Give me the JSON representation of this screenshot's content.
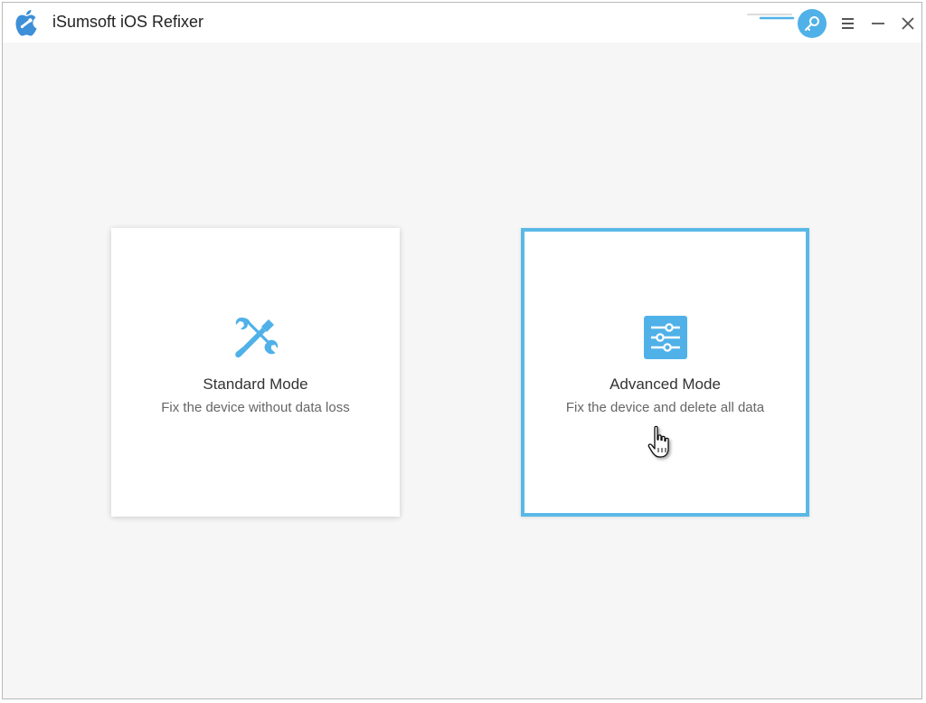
{
  "app": {
    "title": "iSumsoft iOS Refixer"
  },
  "titlebar": {
    "icons": [
      "apple-repair-logo",
      "key-icon",
      "menu-icon",
      "minimize-icon",
      "close-icon"
    ]
  },
  "modes": [
    {
      "title": "Standard Mode",
      "description": "Fix the device without data loss",
      "icon": "tools-icon",
      "selected": false
    },
    {
      "title": "Advanced Mode",
      "description": "Fix the device and delete all data",
      "icon": "sliders-icon",
      "selected": true
    }
  ],
  "colors": {
    "accent": "#4fb1e8",
    "selected_border": "#5ab8e6",
    "background": "#f6f6f6",
    "card": "#ffffff"
  }
}
